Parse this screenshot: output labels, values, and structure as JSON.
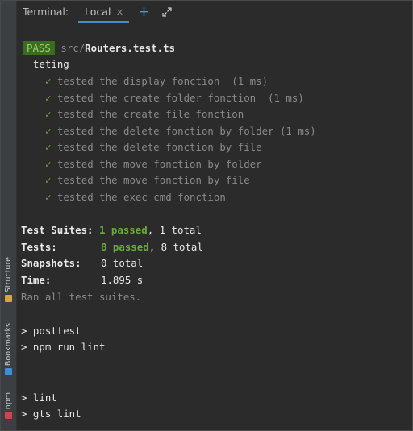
{
  "terminal": {
    "title": "Terminal:",
    "tab_label": "Local",
    "close_glyph": "×",
    "new_tab_glyph": "+",
    "expand_glyph": "⤢"
  },
  "side_tabs": [
    {
      "label": "Structure",
      "icon": "structure-icon",
      "color": "#d9a441"
    },
    {
      "label": "Bookmarks",
      "icon": "bookmark-icon",
      "color": "#3b8fd6"
    },
    {
      "label": "npm",
      "icon": "npm-icon",
      "color": "#c9474a"
    }
  ],
  "output": {
    "pass_badge": "PASS",
    "file_prefix": "src/",
    "file_name": "Routers.test.ts",
    "suite_name": "teting",
    "check_glyph": "✓",
    "tests": [
      "tested the display fonction  (1 ms)",
      "tested the create folder fonction  (1 ms)",
      "tested the create file fonction",
      "tested the delete fonction by folder (1 ms)",
      "tested the delete fonction by file",
      "tested the move fonction by folder",
      "tested the move fonction by file",
      "tested the exec cmd fonction"
    ],
    "summary": {
      "suites_label": "Test Suites:",
      "suites_passed": "1 passed",
      "suites_total": ", 1 total",
      "tests_label": "Tests:",
      "tests_passed": "8 passed",
      "tests_total": ", 8 total",
      "snapshots_label": "Snapshots:",
      "snapshots_value": "0 total",
      "time_label": "Time:",
      "time_value": "1.895 s",
      "ran_all": "Ran all test suites."
    },
    "commands": [
      "> posttest",
      "> npm run lint",
      "> lint",
      "> gts lint"
    ]
  }
}
